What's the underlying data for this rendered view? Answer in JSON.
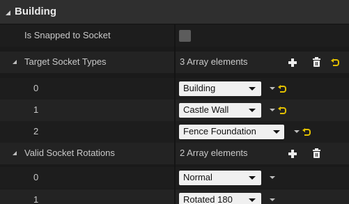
{
  "section": {
    "title": "Building"
  },
  "is_snapped": {
    "label": "Is Snapped to Socket",
    "checked": false
  },
  "target_socket_types": {
    "label": "Target Socket Types",
    "summary": "3 Array elements",
    "elements": [
      {
        "index": "0",
        "value": "Building"
      },
      {
        "index": "1",
        "value": "Castle Wall"
      },
      {
        "index": "2",
        "value": "Fence Foundation"
      }
    ]
  },
  "valid_socket_rotations": {
    "label": "Valid Socket Rotations",
    "summary": "2 Array elements",
    "elements": [
      {
        "index": "0",
        "value": "Normal"
      },
      {
        "index": "1",
        "value": "Rotated 180"
      }
    ]
  },
  "icons": {
    "collapse": "expanded-triangle-icon",
    "add": "plus-icon",
    "clear": "trash-icon",
    "reset": "reset-to-default-icon",
    "combo_arrow": "chevron-down-icon"
  },
  "colors": {
    "header_bg": "#2f2f2f",
    "row_bg": "#1d1d1d",
    "row_alt_bg": "#232323",
    "reset_yellow": "#e2c000",
    "combo_bg": "#f0f0f0"
  }
}
